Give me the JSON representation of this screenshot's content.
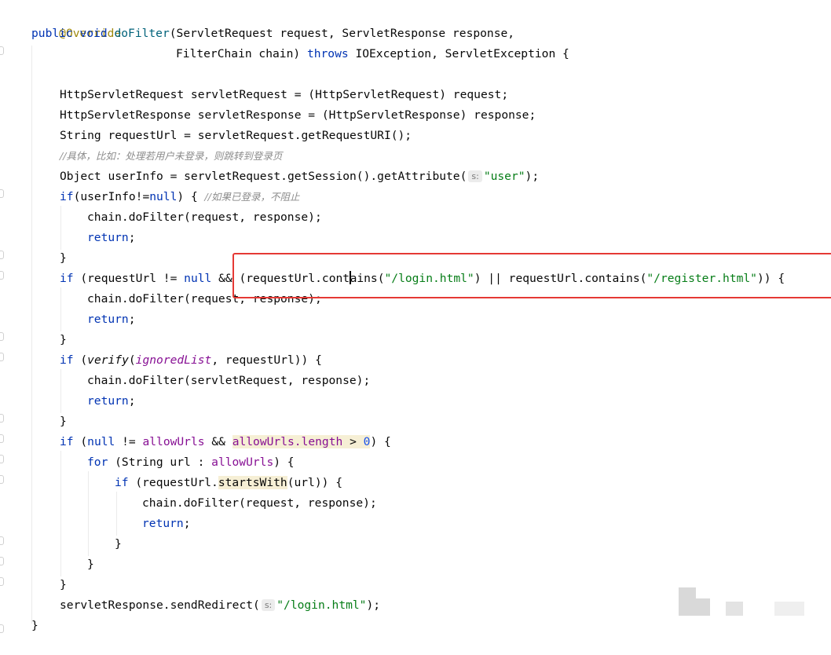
{
  "editor": {
    "annotation": "@Override",
    "sig1": {
      "kw_public": "public",
      "kw_void": "void",
      "method": "doFilter",
      "params": "(ServletRequest request, ServletResponse response,"
    },
    "sig2": {
      "params": "FilterChain chain) ",
      "kw_throws": "throws",
      "rest": " IOException, ServletException {"
    },
    "l_http_req": "HttpServletRequest servletRequest = (HttpServletRequest) request;",
    "l_http_resp": "HttpServletResponse servletResponse = (HttpServletResponse) response;",
    "l_req_url": "String requestUrl = servletRequest.getRequestURI();",
    "comment_redirect": "//具体，比如：处理若用户未登录，则跳转到登录页",
    "l_userinfo": {
      "pre": "Object userInfo = servletRequest.getSession().getAttribute(",
      "hint": "s:",
      "str": "\"user\"",
      "post": ");"
    },
    "l_if_user": {
      "kw_if": "if",
      "mid": "(userInfo!=",
      "kw_null": "null",
      "post": ") { ",
      "comment": "//如果已登录，不阻止"
    },
    "l_chain1": "chain.doFilter(request, response);",
    "kw_return": "return",
    "semicolon": ";",
    "close_brace": "}",
    "l_if_url": {
      "kw_if": "if",
      "p1": " (requestUrl != ",
      "kw_null": "null",
      "p2": " && (requestUrl.cont",
      "p3": "ains(",
      "s1": "\"/login.html\"",
      "p4": ") || requestUrl.contains(",
      "s2": "\"/register.html\"",
      "p5": ")) {"
    },
    "l_chain2": "chain.doFilter(request, response);",
    "l_if_verify": {
      "kw_if": "if",
      "p1": " (",
      "fn": "verify",
      "p2": "(",
      "field": "ignoredList",
      "p3": ", requestUrl)) {"
    },
    "l_chain3": "chain.doFilter(servletRequest, response);",
    "l_if_allow": {
      "kw_if": "if",
      "p1": " (",
      "kw_null": "null",
      "p2": " != ",
      "field": "allowUrls",
      "p3": " && ",
      "hl": "allowUrls.length",
      "p4": " > ",
      "num": "0",
      "p5": ") {"
    },
    "l_for": {
      "kw_for": "for",
      "p1": " (String url : ",
      "field": "allowUrls",
      "p2": ") {"
    },
    "l_if_starts": {
      "kw_if": "if",
      "p1": " (requestUrl.",
      "hl": "startsWith",
      "p2": "(url)) {"
    },
    "l_chain4": "chain.doFilter(request, response);",
    "l_redirect": {
      "pre": "servletResponse.sendRedirect(",
      "hint": "s:",
      "str": "\"/login.html\"",
      "post": ");"
    }
  },
  "colors": {
    "keyword": "#0033b3",
    "annotation": "#9e880d",
    "string": "#067d17",
    "number": "#1750eb",
    "method_decl": "#00627a",
    "field": "#871094",
    "comment": "#8c8c8c",
    "highlight": "#f6efd5",
    "red_box": "#e53935"
  }
}
